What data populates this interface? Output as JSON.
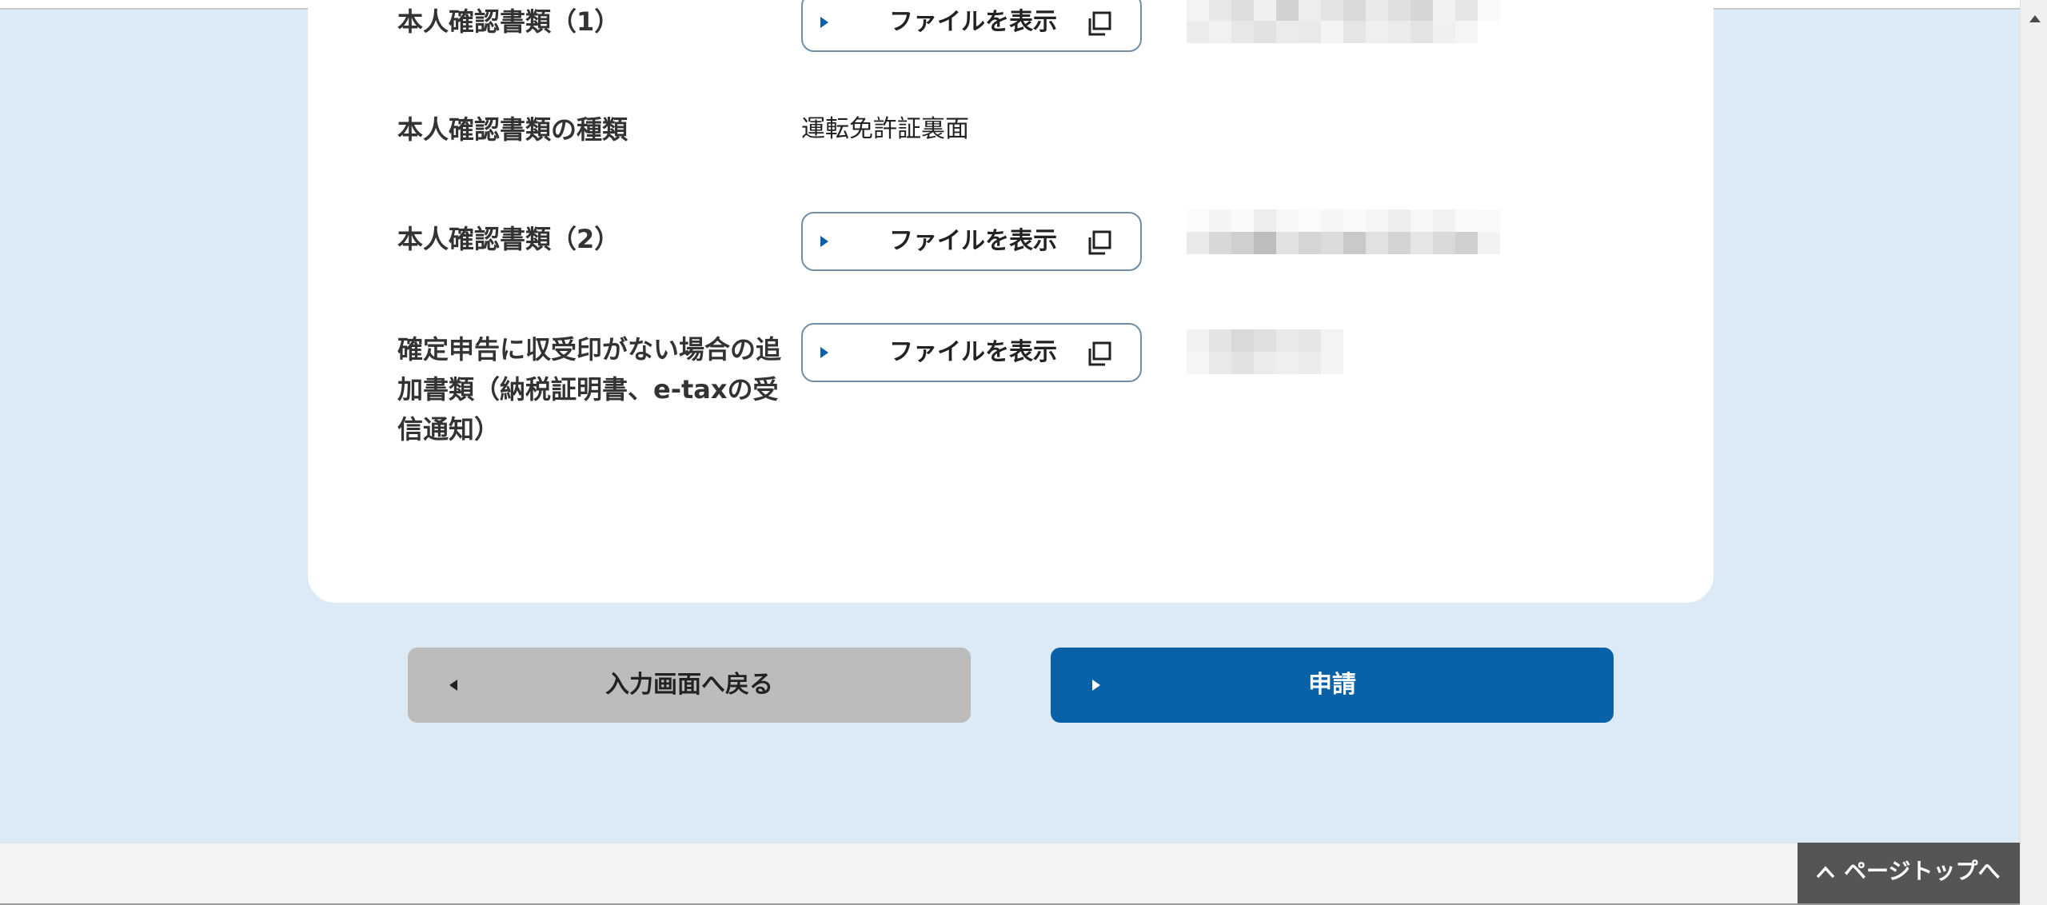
{
  "rows": [
    {
      "label": "本人確認書類（1）",
      "button": "ファイルを表示"
    },
    {
      "label": "本人確認書類の種類",
      "value": "運転免許証裏面"
    },
    {
      "label": "本人確認書類（2）",
      "button": "ファイルを表示"
    },
    {
      "label": "確定申告に収受印がない場合の追加書類（納税証明書、e-taxの受信通知）",
      "button": "ファイルを表示"
    }
  ],
  "actions": {
    "back_label": "入力画面へ戻る",
    "submit_label": "申請"
  },
  "footer": {
    "page_top_label": "ページトップへ"
  },
  "colors": {
    "page_background": "#dbeaf5",
    "primary": "#0961a8",
    "secondary_button": "#bcbcbc",
    "page_top_button": "#555555"
  },
  "icons": {
    "file_button_marker": "triangle-right-icon",
    "file_button_icon": "copy-icon",
    "back_marker": "triangle-left-icon",
    "page_top_icon": "chevron-up-icon"
  }
}
